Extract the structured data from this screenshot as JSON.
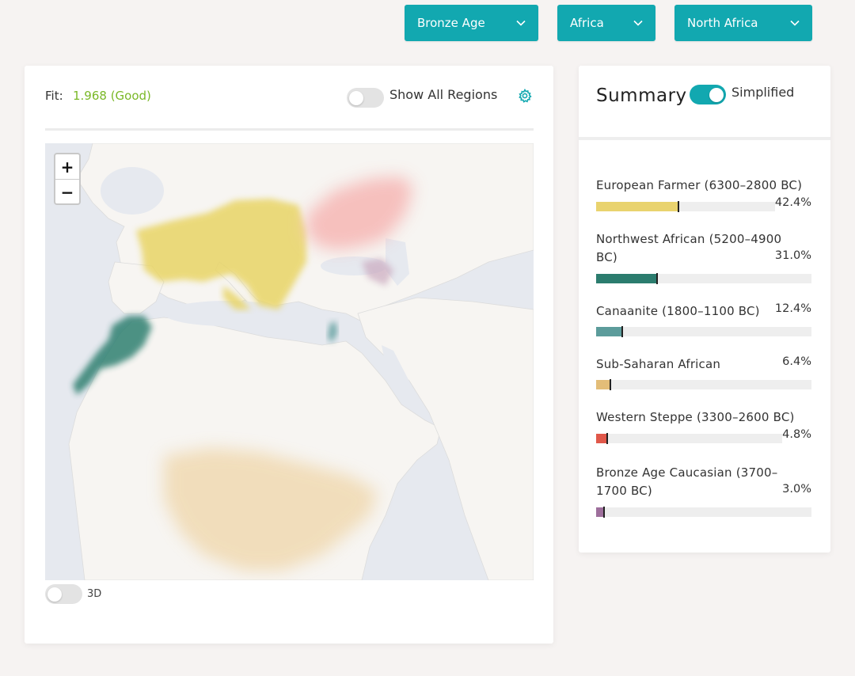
{
  "filters": {
    "period": "Bronze Age",
    "continent": "Africa",
    "region": "North Africa"
  },
  "results": {
    "fit_label": "Fit:",
    "fit_value": "1.968 (Good)",
    "show_all_regions_label": "Show All Regions",
    "show_all_regions_on": false,
    "three_d_label": "3D",
    "three_d_on": false,
    "zoom_in": "+",
    "zoom_out": "−"
  },
  "summary": {
    "title": "Summary",
    "simplified_label": "Simplified",
    "simplified_on": true,
    "components": [
      {
        "name": "European Farmer (6300–2800 BC)",
        "percent": "42.4%",
        "value": 42.4,
        "color": "#e9d36e"
      },
      {
        "name": "Northwest African (5200–4900 BC)",
        "percent": "31.0%",
        "value": 31.0,
        "color": "#2b7c6e"
      },
      {
        "name": "Canaanite (1800–1100 BC)",
        "percent": "12.4%",
        "value": 12.4,
        "color": "#5c9c9b"
      },
      {
        "name": "Sub-Saharan African",
        "percent": "6.4%",
        "value": 6.4,
        "color": "#e3bd78"
      },
      {
        "name": "Western Steppe (3300–2600 BC)",
        "percent": "4.8%",
        "value": 4.8,
        "color": "#e0584a"
      },
      {
        "name": "Bronze Age Caucasian (3700–1700 BC)",
        "percent": "3.0%",
        "value": 3.0,
        "color": "#9e6f9c"
      }
    ]
  },
  "colors": {
    "accent": "#12a8b0",
    "fit_good": "#7ab827"
  }
}
